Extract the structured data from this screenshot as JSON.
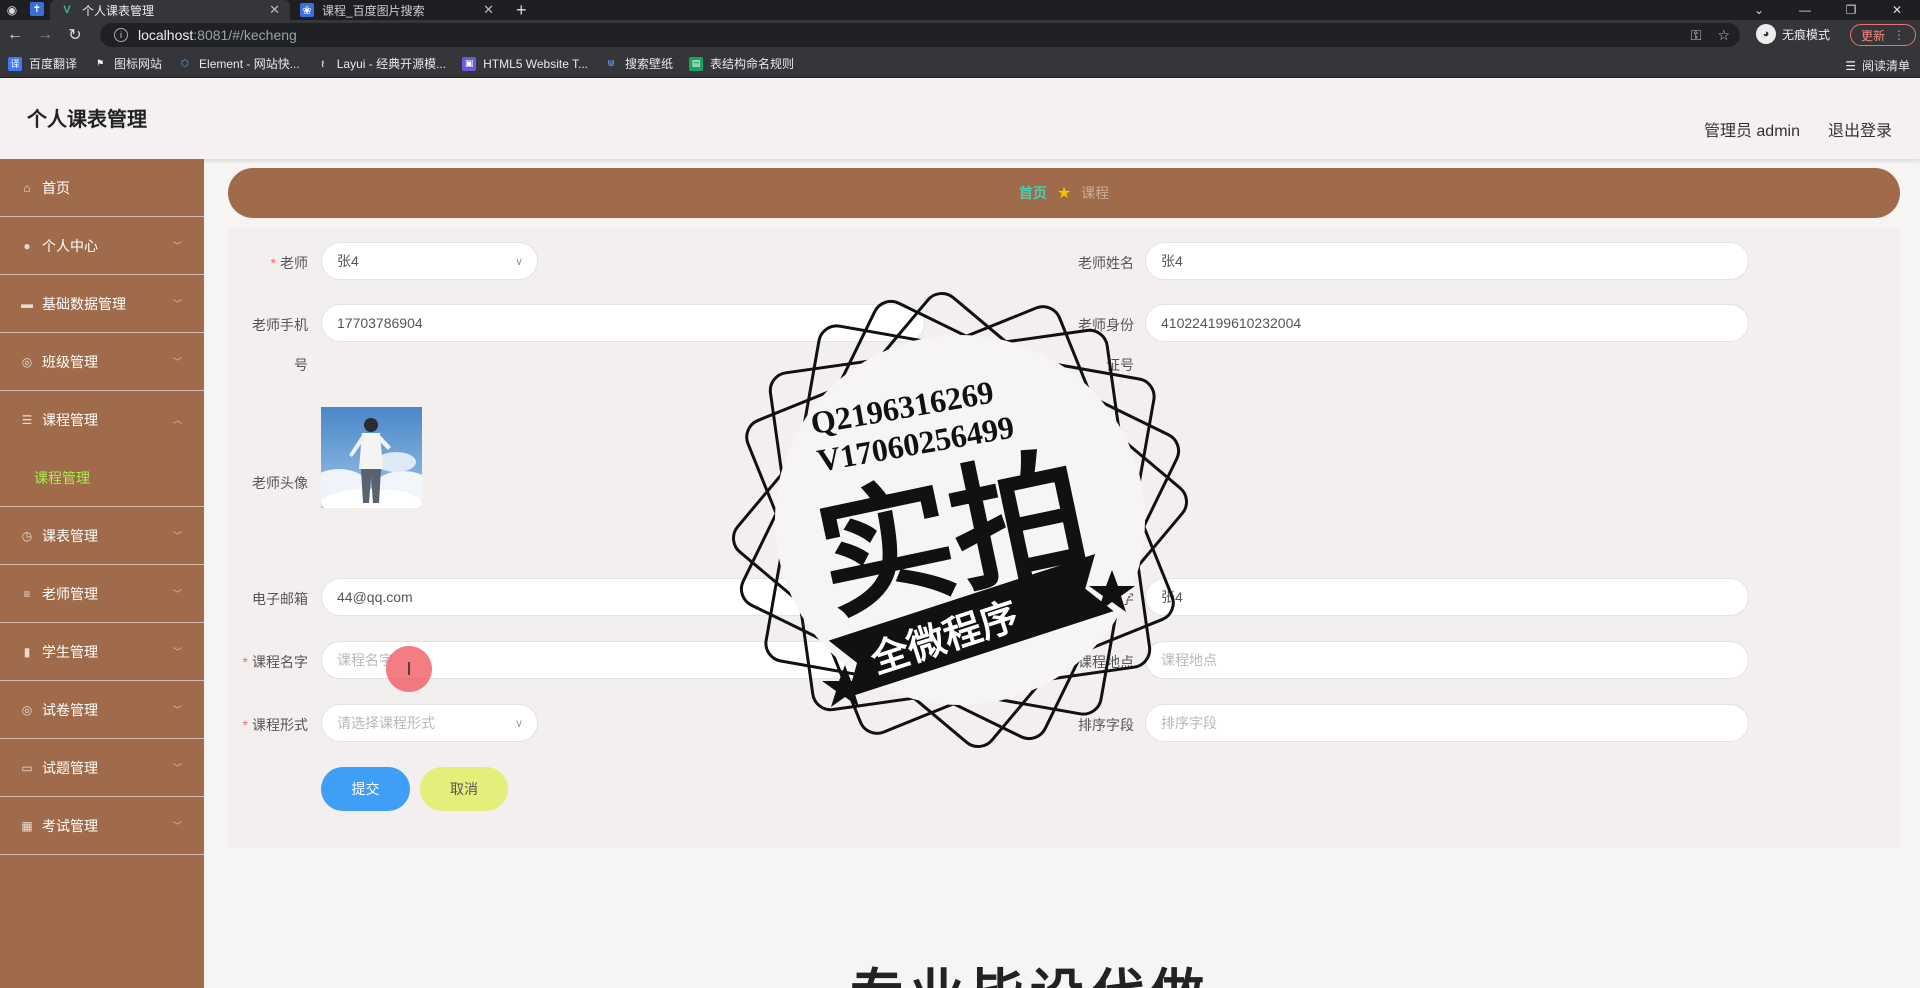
{
  "browser": {
    "tabs": [
      {
        "title": "个人课表管理",
        "active": true
      },
      {
        "title": "课程_百度图片搜索",
        "active": false
      }
    ],
    "url_host": "localhost",
    "url_path": ":8081/#/kecheng",
    "incognito_label": "无痕模式",
    "update_label": "更新",
    "bookmarks": [
      {
        "label": "百度翻译",
        "icon": "translate-icon",
        "color": "#3b7cf6"
      },
      {
        "label": "图标网站",
        "icon": "flag-icon",
        "color": "#35363a"
      },
      {
        "label": "Element - 网站快...",
        "icon": "element-icon",
        "color": "#409eff"
      },
      {
        "label": "Layui - 经典开源模...",
        "icon": "layui-icon",
        "color": "#35363a"
      },
      {
        "label": "HTML5 Website T...",
        "icon": "html5-icon",
        "color": "#6b5bd6"
      },
      {
        "label": "搜索壁纸",
        "icon": "wallpaper-icon",
        "color": "#4a90e2"
      },
      {
        "label": "表结构命名规则",
        "icon": "sheet-icon",
        "color": "#1aa260"
      }
    ],
    "reading_list": "阅读清单"
  },
  "header": {
    "title": "个人课表管理",
    "user": "管理员 admin",
    "logout": "退出登录"
  },
  "sidebar": {
    "items": [
      {
        "label": "首页",
        "icon": "home-icon",
        "arrow": false
      },
      {
        "label": "个人中心",
        "icon": "user-icon",
        "arrow": true
      },
      {
        "label": "基础数据管理",
        "icon": "monitor-icon",
        "arrow": true
      },
      {
        "label": "班级管理",
        "icon": "globe-icon",
        "arrow": true
      },
      {
        "label": "课程管理",
        "icon": "sliders-icon",
        "arrow": true,
        "open": true
      },
      {
        "label": "课表管理",
        "icon": "compass-icon",
        "arrow": true
      },
      {
        "label": "老师管理",
        "icon": "list-icon",
        "arrow": true
      },
      {
        "label": "学生管理",
        "icon": "bar-chart-icon",
        "arrow": true
      },
      {
        "label": "试卷管理",
        "icon": "globe-icon",
        "arrow": true
      },
      {
        "label": "试题管理",
        "icon": "briefcase-icon",
        "arrow": true
      },
      {
        "label": "考试管理",
        "icon": "grid-icon",
        "arrow": true
      }
    ],
    "submenu": "课程管理"
  },
  "breadcrumb": {
    "home": "首页",
    "current": "课程"
  },
  "form": {
    "teacher_label": "老师",
    "teacher_value": "张4",
    "teacher_name_label": "老师姓名",
    "teacher_name_value": "张4",
    "teacher_phone_label_1": "老师手机",
    "teacher_phone_label_2": "号",
    "teacher_phone_value": "17703786904",
    "teacher_id_label_1": "老师身份",
    "teacher_id_label_2": "证号",
    "teacher_id_value": "410224199610232004",
    "avatar_label": "老师头像",
    "email_label": "电子邮箱",
    "email_value": "44@qq.com",
    "course_teacher_label": "老师名字",
    "course_teacher_value": "张4",
    "course_name_label": "课程名字",
    "course_name_placeholder": "课程名字",
    "course_place_label": "课程地点",
    "course_place_placeholder": "课程地点",
    "course_form_label": "课程形式",
    "course_form_placeholder": "请选择课程形式",
    "sort_label": "排序字段",
    "sort_placeholder": "排序字段",
    "submit": "提交",
    "cancel": "取消"
  },
  "watermark": {
    "line1": "Q2196316269",
    "line2": "V17060256499",
    "big": "实拍",
    "ribbon": "全微程序"
  },
  "bottom_text": "专业毕设代做"
}
